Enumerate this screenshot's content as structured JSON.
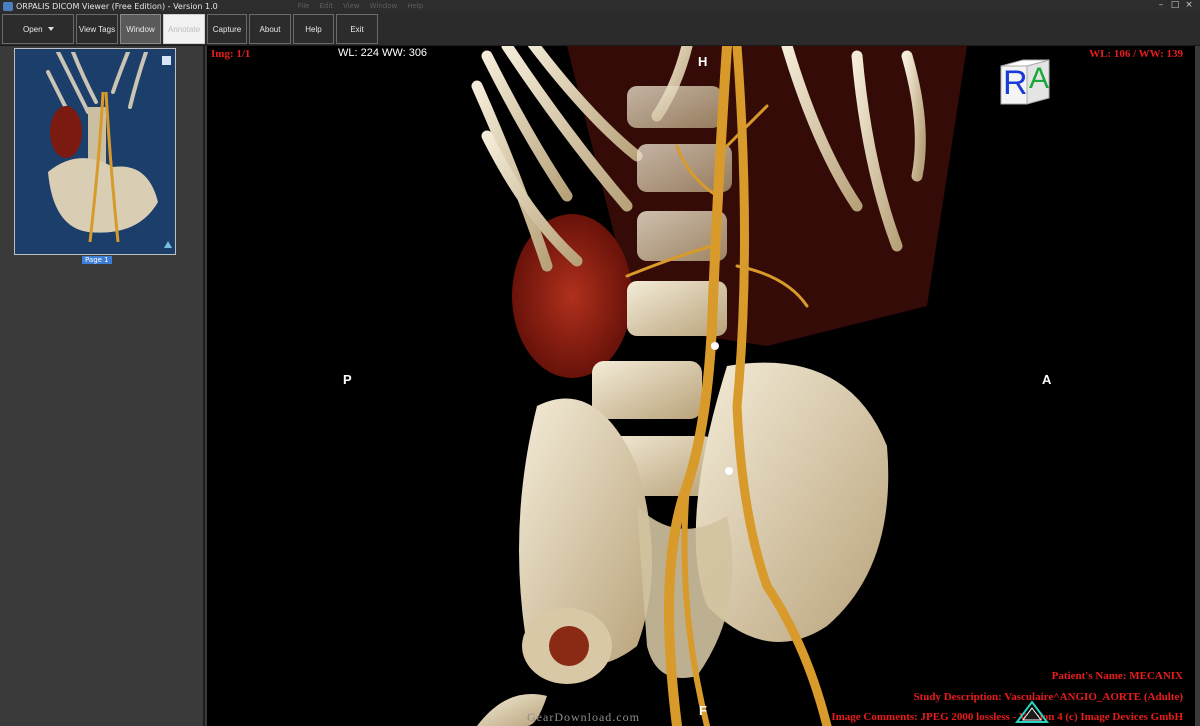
{
  "window": {
    "title": "ORPALIS DICOM Viewer (Free Edition) - Version 1.0",
    "ghost_menu": [
      "File",
      "Edit",
      "View",
      "Window",
      "Help"
    ],
    "controls": [
      "–",
      "□",
      "×"
    ]
  },
  "toolbar": {
    "open": "Open",
    "view_tags": "View Tags",
    "window": "Window",
    "pressed": "Annotate",
    "capture": "Capture",
    "about": "About",
    "help": "Help",
    "exit": "Exit"
  },
  "sidebar": {
    "page_label": "Page 1"
  },
  "viewer": {
    "img_counter": "Img: 1/1",
    "wl_ww_left": "WL: 224 WW: 306",
    "wl_ww_right": "WL: 106 / WW: 139",
    "orientation": {
      "top": "H",
      "left": "P",
      "right": "A",
      "bottom": "F"
    },
    "cube_letters": {
      "front": "R",
      "side": "A"
    },
    "patient_name": "Patient's Name: MECANIX",
    "study_description": "Study Description: Vasculaire^ANGIO_AORTE (Adulte)",
    "image_comments": "Image Comments: JPEG 2000 lossless - Version 4 (c) Image Devices GmbH",
    "watermark": "GearDownload.com"
  },
  "colors": {
    "overlay_red": "#e81c1c",
    "selection_blue": "#3d7fd6",
    "thumbnail_bg": "#1c3e6b",
    "bone": "#e8dcc0",
    "vessel": "#d89a2a",
    "organ": "#8a1a10"
  }
}
